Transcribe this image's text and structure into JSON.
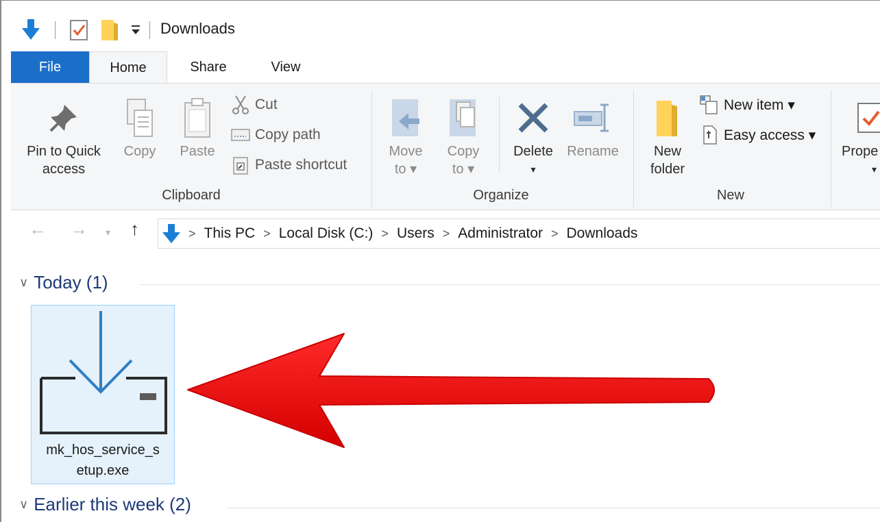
{
  "window": {
    "title": "Downloads"
  },
  "tabs": {
    "file": "File",
    "home": "Home",
    "share": "Share",
    "view": "View"
  },
  "ribbon": {
    "clipboard": {
      "label": "Clipboard",
      "pin_line1": "Pin to Quick",
      "pin_line2": "access",
      "copy": "Copy",
      "paste": "Paste",
      "cut": "Cut",
      "copy_path": "Copy path",
      "paste_shortcut": "Paste shortcut"
    },
    "organize": {
      "label": "Organize",
      "move_line1": "Move",
      "move_line2": "to ▾",
      "copy_line1": "Copy",
      "copy_line2": "to ▾",
      "delete": "Delete",
      "delete_arrow": "▾",
      "rename": "Rename"
    },
    "new": {
      "label": "New",
      "new_folder_line1": "New",
      "new_folder_line2": "folder",
      "new_item": "New item ▾",
      "easy_access": "Easy access ▾"
    },
    "open": {
      "properties": "Prope",
      "properties_arrow": "▾"
    }
  },
  "address": {
    "crumbs": [
      "This PC",
      "Local Disk (C:)",
      "Users",
      "Administrator",
      "Downloads"
    ],
    "separator": ">"
  },
  "groups": [
    {
      "title": "Today (1)"
    },
    {
      "title": "Earlier this week (2)"
    }
  ],
  "files": [
    {
      "name_line1": "mk_hos_service_s",
      "name_line2": "etup.exe",
      "icon": "download-installer-icon"
    }
  ],
  "colors": {
    "accent": "#1b6fc9",
    "arrow": "#ff0000",
    "group_heading": "#1e3a78",
    "selection_bg": "#e5f1fb",
    "selection_border": "#99d1ff"
  }
}
